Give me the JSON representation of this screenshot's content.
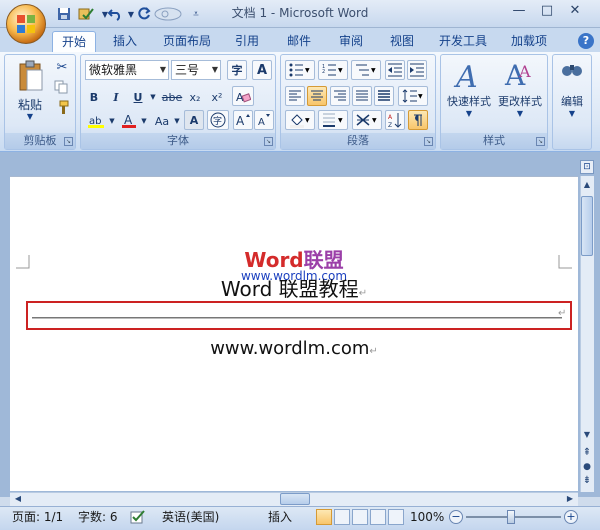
{
  "window": {
    "title": "文档 1 - Microsoft Word"
  },
  "quick_access": {
    "icons": [
      "save-icon",
      "undo-icon",
      "redo-icon"
    ]
  },
  "tabs": [
    {
      "label": "开始",
      "active": true
    },
    {
      "label": "插入"
    },
    {
      "label": "页面布局"
    },
    {
      "label": "引用"
    },
    {
      "label": "邮件"
    },
    {
      "label": "审阅"
    },
    {
      "label": "视图"
    },
    {
      "label": "开发工具"
    },
    {
      "label": "加载项"
    }
  ],
  "clipboard": {
    "paste_label": "粘贴",
    "group_label": "剪贴板"
  },
  "font": {
    "name": "微软雅黑",
    "size": "三号",
    "group_label": "字体",
    "bold": "B",
    "italic": "I",
    "underline": "U",
    "strike": "abe",
    "sub": "x₂",
    "sup": "x²",
    "grow": "A",
    "shrink": "A",
    "clear": "A",
    "aa": "Aa",
    "phon": "wén",
    "border": "A",
    "wen": "字"
  },
  "paragraph": {
    "group_label": "段落"
  },
  "styles": {
    "quick_styles": "快速样式",
    "change_styles": "更改样式",
    "group_label": "样式"
  },
  "editing": {
    "label": "编辑"
  },
  "document": {
    "watermark_word": "Word",
    "watermark_lm": "联盟",
    "watermark_url": "www.wordlm.com",
    "heading": "Word 联盟教程",
    "url_line": "www.wordlm.com",
    "para_mark": "↵"
  },
  "status": {
    "page": "页面: 1/1",
    "words": "字数: 6",
    "language": "英语(美国)",
    "mode": "插入",
    "zoom": "100%"
  },
  "colors": {
    "accent": "#15428b",
    "highlight_box": "#cc2222"
  }
}
